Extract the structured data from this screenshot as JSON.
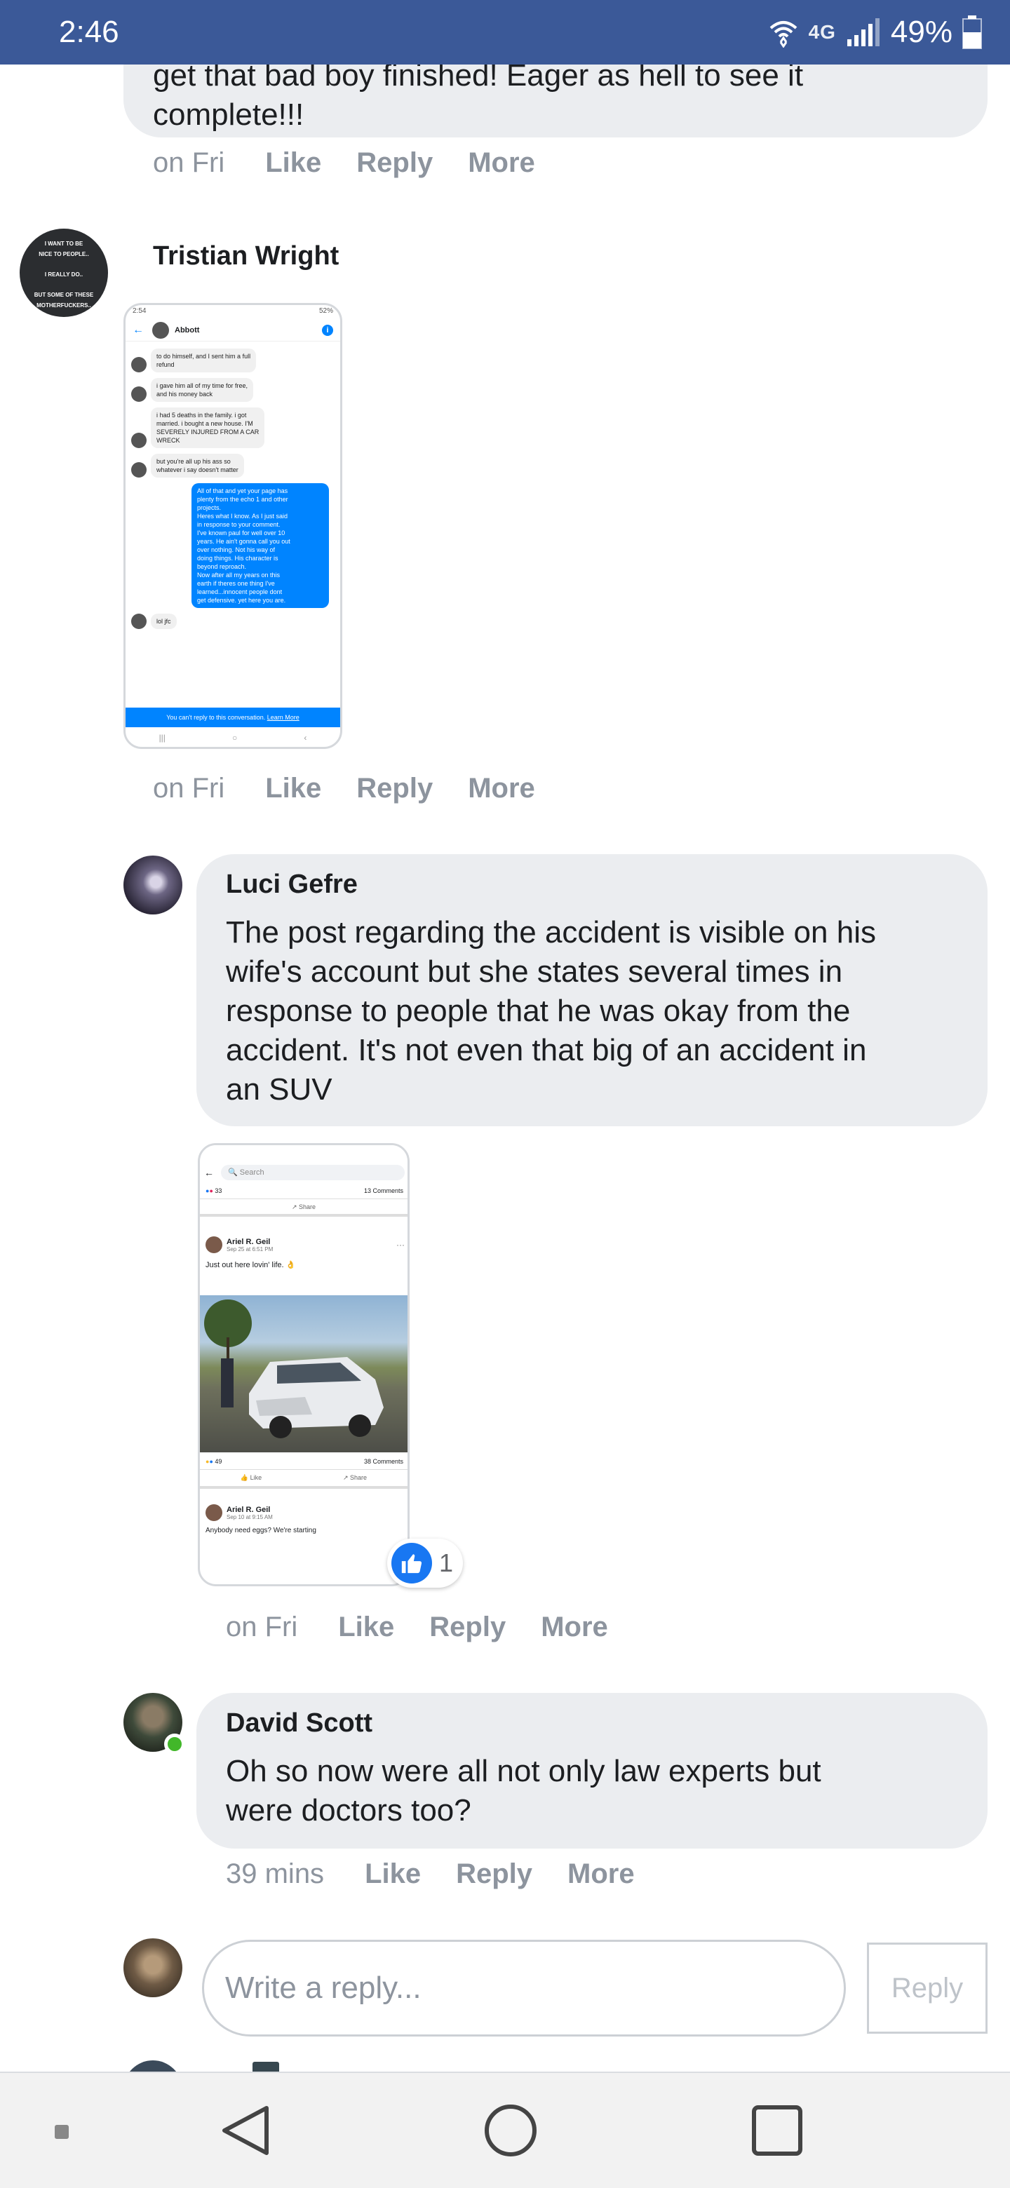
{
  "status_bar": {
    "time": "2:46",
    "network": "4G",
    "battery": "49%"
  },
  "comments": [
    {
      "partial_text_line1": "get that bad boy finished! Eager as hell to see it",
      "partial_text_line2": "complete!!!",
      "time": "on Fri"
    },
    {
      "author": "Tristian Wright",
      "avatar_text": [
        "I WANT TO BE",
        "NICE TO PEOPLE..",
        "I REALLY DO..",
        "BUT SOME OF THESE",
        "MOTHERFUCKERS.."
      ],
      "time": "on Fri",
      "screenshot": {
        "status_left": "2:54",
        "status_right": "52%",
        "contact": "Abbott",
        "messages": [
          {
            "from": "them",
            "lines": [
              "to do himself, and I sent him a full",
              "refund"
            ]
          },
          {
            "from": "them",
            "lines": [
              "i gave him all of my time for free,",
              "and his money back"
            ]
          },
          {
            "from": "them",
            "lines": [
              "i had 5 deaths in the family. i got",
              "married. i bought a new house. I'M",
              "SEVERELY INJURED FROM A CAR",
              "WRECK"
            ]
          },
          {
            "from": "them",
            "lines": [
              "but you're all up his ass so",
              "whatever i say doesn't matter"
            ]
          },
          {
            "from": "me",
            "lines": [
              "All of that and yet your page has",
              "plenty from the echo 1 and other",
              "projects.",
              "Heres what I know. As I just said",
              "in response to your comment.",
              "I've known paul for well over 10",
              "years. He ain't gonna call you out",
              "over nothing. Not his way of",
              "doing things. His character is",
              "beyond reproach.",
              "Now after all my years on this",
              "earth if theres one thing I've",
              "learned...innocent people dont",
              "get defensive. yet here you are."
            ]
          },
          {
            "from": "them",
            "lines": [
              "lol jfc"
            ]
          }
        ],
        "footer_text": "You can't reply to this conversation.",
        "footer_link": "Learn More"
      }
    },
    {
      "author": "Luci Gefre",
      "text_lines": [
        "The post regarding the accident is visible on his",
        "wife's account but she states several times in",
        "response to people that he was okay from the",
        "accident. It's not even that big of an accident in",
        "an SUV"
      ],
      "time": "on Fri",
      "reaction_count": "1",
      "screenshot": {
        "search_placeholder": "Search",
        "reactions1": "33",
        "comments1": "13 Comments",
        "share": "Share",
        "post_author": "Ariel R. Geil",
        "post_date": "Sep 25 at 6:51 PM",
        "post_text": "Just out here lovin' life. 👌",
        "reactions2": "49",
        "comments2": "38 Comments",
        "like": "Like",
        "post2_author": "Ariel R. Geil",
        "post2_date": "Sep 10 at 9:15 AM",
        "post2_text": "Anybody need eggs? We're starting"
      }
    },
    {
      "author": "David Scott",
      "text_lines": [
        "Oh so now were all not only law experts but",
        "were doctors too?"
      ],
      "time": "39 mins",
      "online": true
    }
  ],
  "actions": {
    "like": "Like",
    "reply": "Reply",
    "more": "More"
  },
  "composer": {
    "placeholder": "Write a reply...",
    "button": "Reply"
  },
  "colors": {
    "status_bar": "#3b5998",
    "bubble": "#ebedf0",
    "meta_text": "#8d949e",
    "messenger_blue": "#0084ff",
    "online": "#42b72a"
  }
}
